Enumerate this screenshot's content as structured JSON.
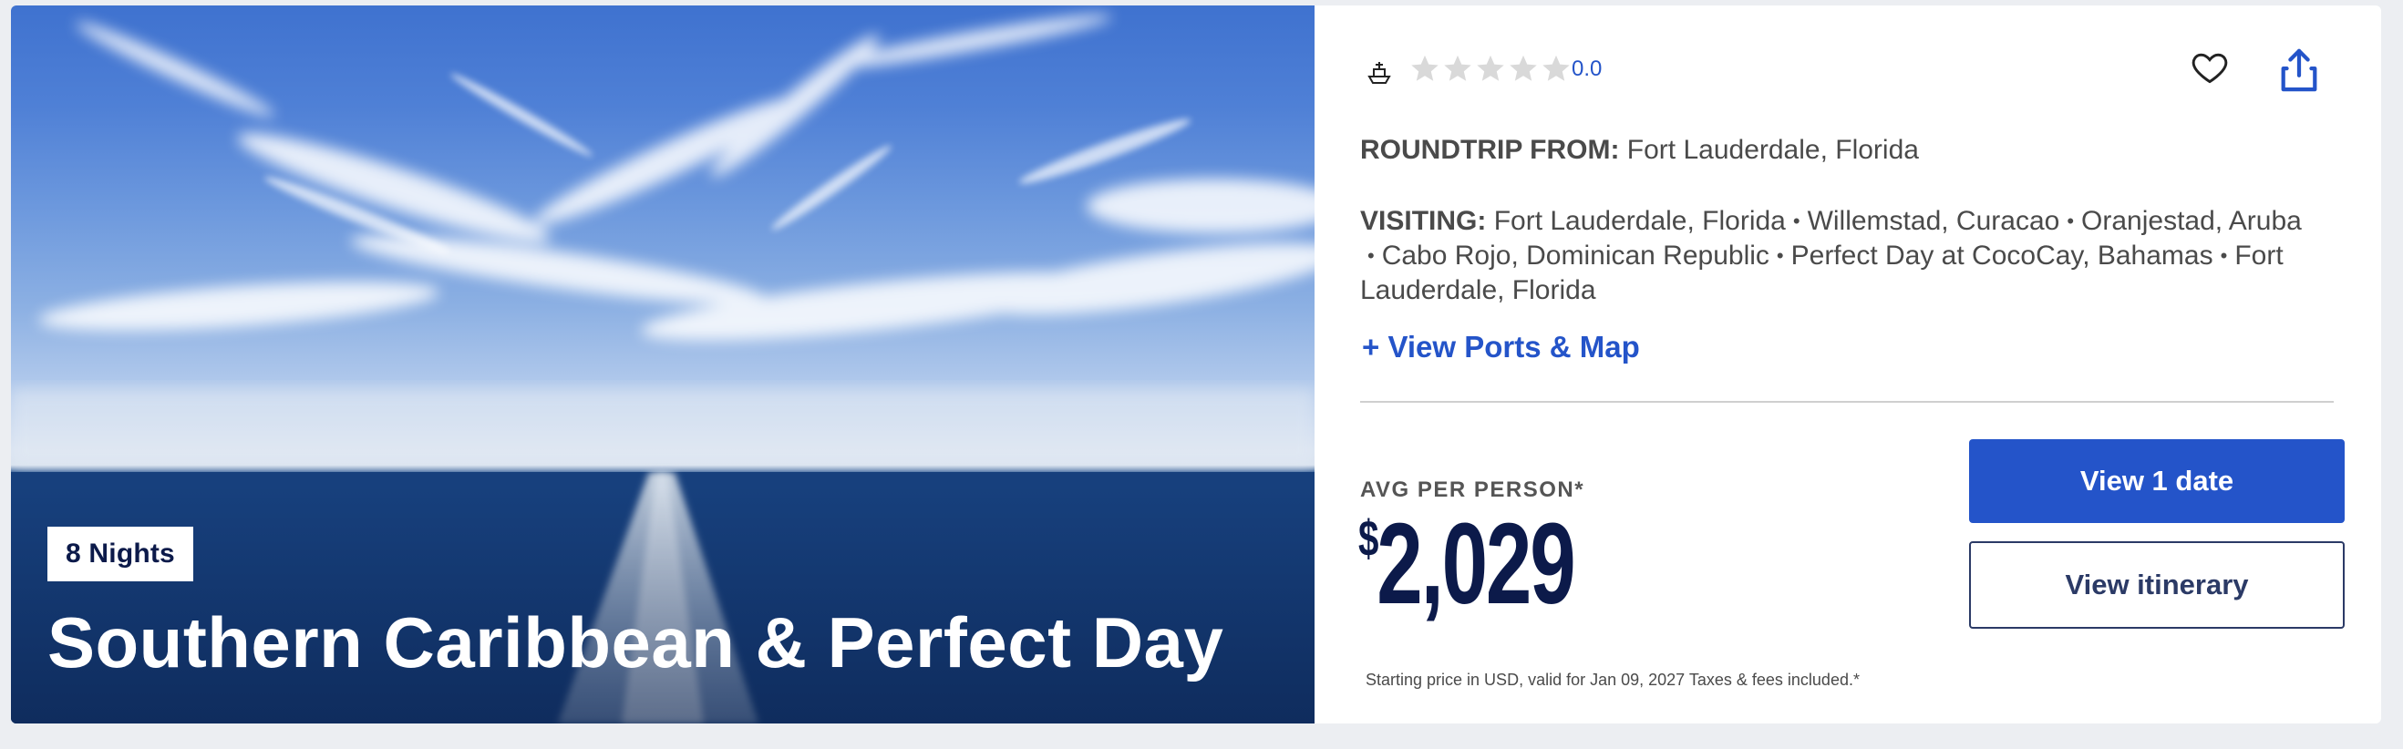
{
  "hero": {
    "nights_badge": "8 Nights",
    "title": "Southern Caribbean & Perfect Day"
  },
  "rating": {
    "stars_filled": 0,
    "stars_total": 5,
    "value": "0.0"
  },
  "icons": {
    "ship": "ship-icon",
    "favorite": "heart-icon",
    "share": "share-icon",
    "star": "star-icon"
  },
  "itinerary": {
    "roundtrip_label": "ROUNDTRIP FROM:",
    "roundtrip_value": "Fort Lauderdale, Florida",
    "visiting_label": "VISITING:",
    "ports": [
      "Fort Lauderdale, Florida",
      "Willemstad, Curacao",
      "Oranjestad, Aruba",
      "Cabo Rojo, Dominican Republic",
      "Perfect Day at CocoCay, Bahamas",
      "Fort Lauderdale, Florida"
    ],
    "separator": "•",
    "view_ports_link": "+ View Ports & Map"
  },
  "pricing": {
    "avg_label": "AVG PER PERSON*",
    "currency_symbol": "$",
    "amount": "2,029",
    "disclaimer": "Starting price in USD, valid for Jan 09, 2027 Taxes & fees included.*"
  },
  "actions": {
    "view_dates_label": "View 1 date",
    "view_itinerary_label": "View itinerary"
  },
  "colors": {
    "accent_blue": "#2454c9",
    "navy": "#0c1a4a",
    "text_gray": "#4a4a4a",
    "star_empty": "#d9d9d9",
    "page_bg": "#eceef2"
  }
}
